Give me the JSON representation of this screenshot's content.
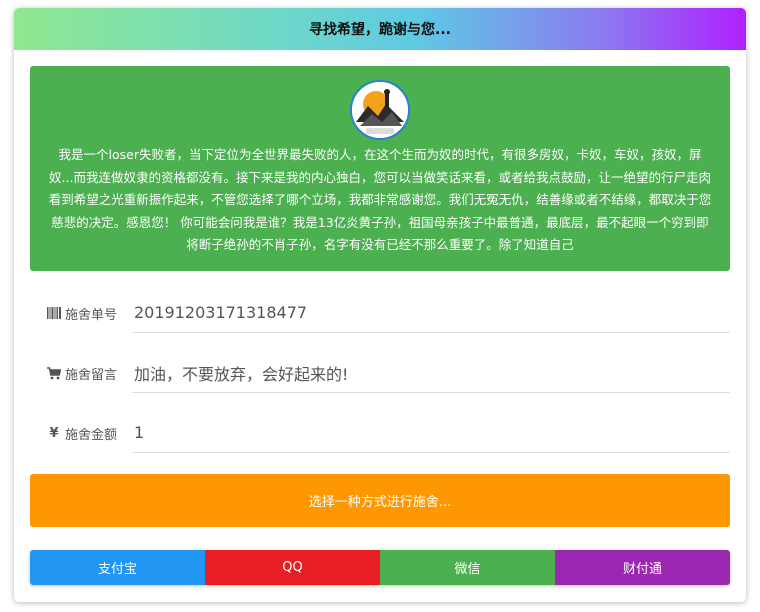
{
  "header": {
    "title": "寻找希望，跪谢与您..."
  },
  "intro": {
    "text": "我是一个loser失败者，当下定位为全世界最失败的人，在这个生而为奴的时代，有很多房奴，卡奴，车奴，孩奴，屏奴...而我连做奴隶的资格都没有。接下来是我的内心独白，您可以当做笑话来看，或者给我点鼓励，让一绝望的行尸走肉看到希望之光重新振作起来，不管您选择了哪个立场，我都非常感谢您。我们无冤无仇，结善缘或者不结缘，都取决于您慈悲的决定。感恩您！ 你可能会问我是谁？我是13亿炎黄子孙，祖国母亲孩子中最普通，最底层，最不起眼一个穷到即将断子绝孙的不肖子孙，名字有没有已经不那么重要了。除了知道自己"
  },
  "form": {
    "order_label": "施舍单号",
    "order_value": "20191203171318477",
    "message_label": "施舍留言",
    "message_value": "加油，不要放弃，会好起来的!",
    "amount_label": "施舍金额",
    "amount_value": "1",
    "amount_icon": "¥"
  },
  "choose_label": "选择一种方式进行施舍...",
  "payments": [
    {
      "label": "支付宝",
      "color": "#2196f3"
    },
    {
      "label": "QQ",
      "color": "#e91e25"
    },
    {
      "label": "微信",
      "color": "#4caf50"
    },
    {
      "label": "财付通",
      "color": "#9c27b0"
    }
  ]
}
